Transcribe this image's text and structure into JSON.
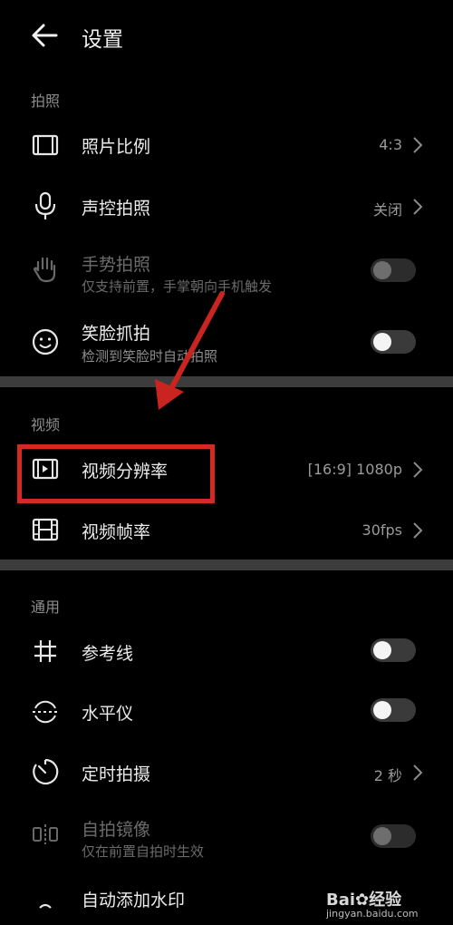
{
  "header": {
    "title": "设置"
  },
  "sections": {
    "photo": "拍照",
    "video": "视频",
    "general": "通用"
  },
  "photo": {
    "ratio": {
      "title": "照片比例",
      "value": "4:3"
    },
    "voice": {
      "title": "声控拍照",
      "value": "关闭"
    },
    "gesture": {
      "title": "手势拍照",
      "subtitle": "仅支持前置，手掌朝向手机触发",
      "enabled": false
    },
    "smile": {
      "title": "笑脸抓拍",
      "subtitle": "检测到笑脸时自动拍照",
      "on": false
    }
  },
  "video": {
    "resolution": {
      "title": "视频分辨率",
      "value": "[16:9] 1080p"
    },
    "framerate": {
      "title": "视频帧率",
      "value": "30fps"
    }
  },
  "general": {
    "grid": {
      "title": "参考线",
      "on": false
    },
    "level": {
      "title": "水平仪",
      "on": false
    },
    "timer": {
      "title": "定时拍摄",
      "value": "2 秒"
    },
    "mirror": {
      "title": "自拍镜像",
      "subtitle": "仅在前置自拍时生效",
      "enabled": false
    },
    "watermark": {
      "title": "自动添加水印"
    }
  },
  "watermark": {
    "brand": "Bai",
    "brand_suffix": "经验",
    "site": "jingyan.baidu.com"
  },
  "colors": {
    "background": "#000000",
    "divider": "#3c3c3c",
    "annotation": "#d42a24",
    "toggle_track": "#3a3a3a",
    "toggle_knob": "#f4f4f4"
  },
  "icons": {
    "back": "arrow-left-icon",
    "ratio": "film-frame-icon",
    "voice": "microphone-icon",
    "gesture": "hand-icon",
    "smile": "smiley-icon",
    "resolution": "video-play-frame-icon",
    "framerate": "film-strip-icon",
    "grid": "grid-hash-icon",
    "level": "level-icon",
    "timer": "timer-icon",
    "mirror": "mirror-icon",
    "watermark": "watermark-icon"
  }
}
